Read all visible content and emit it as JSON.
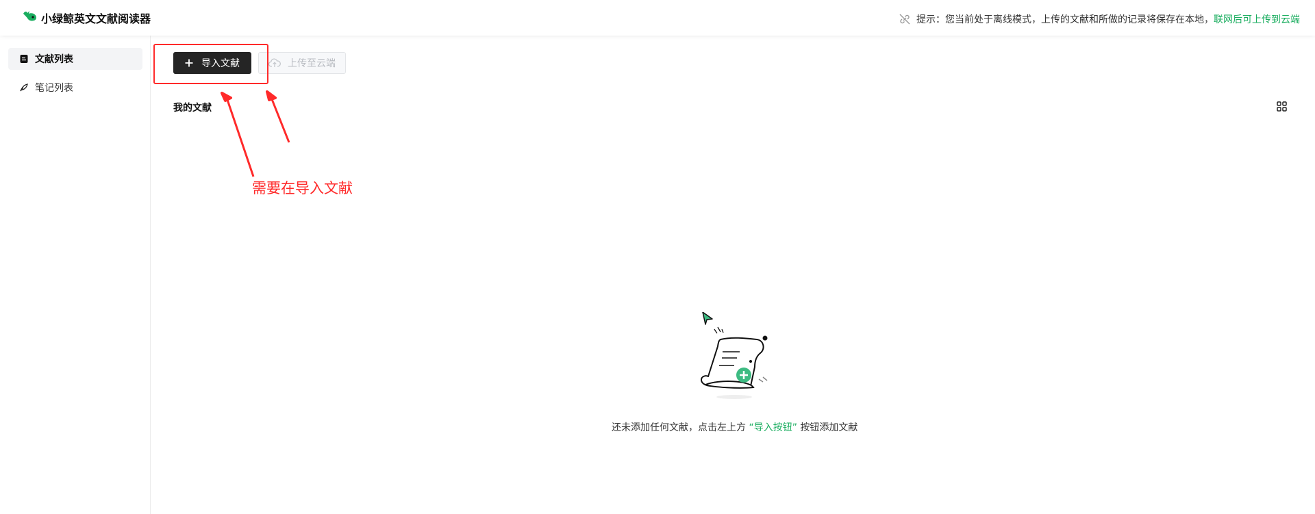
{
  "app": {
    "title": "小绿鲸英文文献阅读器"
  },
  "notice": {
    "text": "提示：您当前处于离线模式，上传的文献和所做的记录将保存在本地，",
    "link": "联网后可上传到云端"
  },
  "sidebar": {
    "items": [
      {
        "label": "文献列表",
        "icon": "document-icon",
        "active": true
      },
      {
        "label": "笔记列表",
        "icon": "feather-pen-icon",
        "active": false
      }
    ]
  },
  "toolbar": {
    "import_label": "导入文献",
    "upload_label": "上传至云端"
  },
  "section": {
    "title": "我的文献"
  },
  "empty_state": {
    "before": "还未添加任何文献，点击左上方 ",
    "highlight": "“导入按钮”",
    "after": " 按钮添加文献"
  },
  "annotation": {
    "text": "需要在导入文献"
  },
  "colors": {
    "brand_green": "#1aad5f",
    "annotation_red": "#ff2a2a",
    "primary_button": "#252525"
  }
}
